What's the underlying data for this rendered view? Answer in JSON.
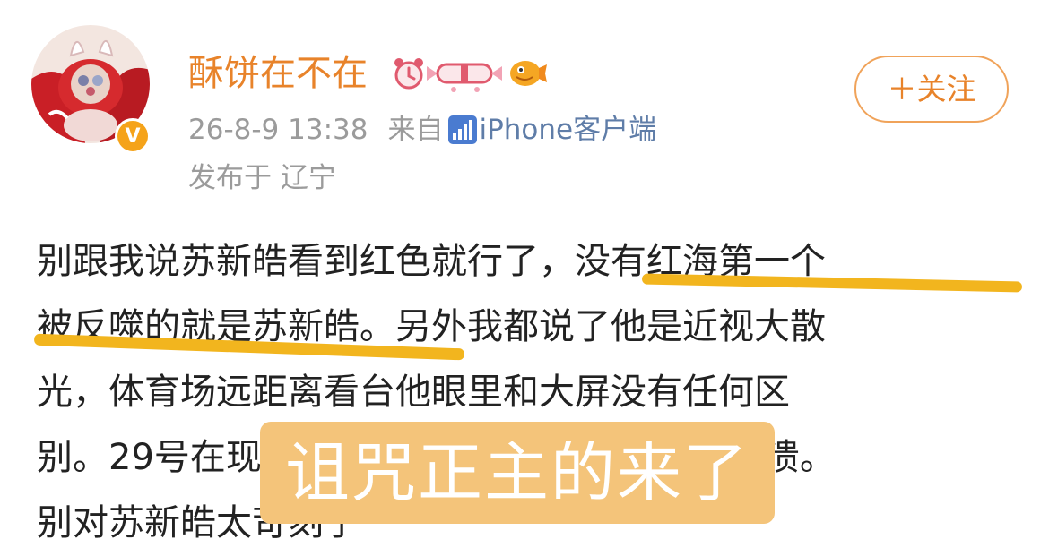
{
  "header": {
    "user_name": "酥饼在不在",
    "verified_badge": "V",
    "meta_time": "26-8-9 13:38",
    "meta_from": "来自",
    "meta_client": "iPhone客户端",
    "location": "发布于 辽宁",
    "follow_label": "＋关注"
  },
  "post": {
    "lines": [
      "别跟我说苏新皓看到红色就行了，没有红海第一个",
      "被反噬的就是苏新皓。另外我都说了他是近视大散",
      "光，体育场远距离看台他眼里和大屏没有任何区",
      "别。29号在现场看他出的时候，都说自己很崩溃。",
      "别对苏新皓太苛刻了"
    ]
  },
  "overlay": {
    "sticker_text": "诅咒正主的来了"
  },
  "colors": {
    "name": "#e8832a",
    "meta_grey": "#9b9b9b",
    "client_blue": "#5f7da8",
    "follow_border": "#f0a35a",
    "underline": "#f2b51e",
    "sticker_bg": "#f4c47a",
    "verified": "#f5a31a"
  },
  "icons": {
    "avatar": "avatar-image",
    "verified": "verified-v-icon",
    "badges": [
      "alarm-clock-badge-icon",
      "candy-badge-icon",
      "pufferfish-badge-icon"
    ],
    "signal": "signal-bars-icon"
  }
}
